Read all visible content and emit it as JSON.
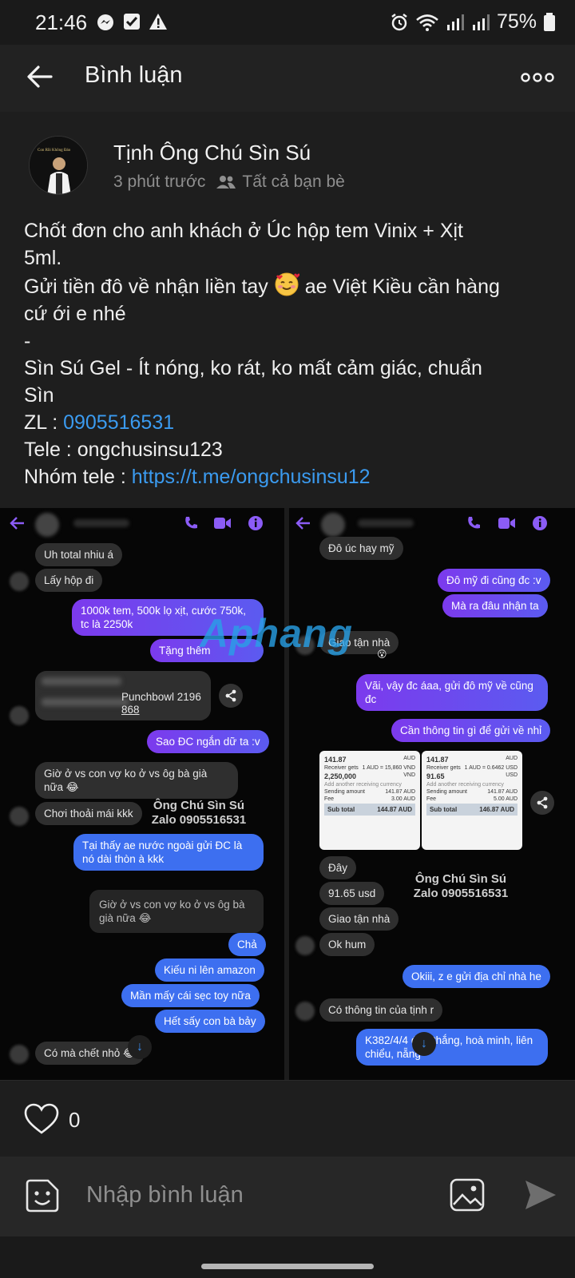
{
  "status_bar": {
    "time": "21:46",
    "battery": "75%"
  },
  "header": {
    "title": "Bình luận"
  },
  "post": {
    "author": "Tịnh Ông Chú Sìn Sú",
    "time": "3 phút trước",
    "audience": "Tất cả bạn bè",
    "lines": [
      "Chốt đơn cho anh khách ở Úc hộp tem Vinix + Xịt",
      "5ml.",
      "Gửi tiền đô về nhận liền tay",
      "ae Việt Kiều cần hàng",
      "cứ ới e nhé",
      "-",
      "Sìn Sú Gel - Ít nóng, ko rát, ko mất cảm giác, chuẩn",
      "Sìn",
      "ZL : ",
      "0905516531",
      "Tele : ongchusinsu123",
      "Nhóm tele : ",
      "https://t.me/ongchusinsu12"
    ]
  },
  "collage": {
    "brand": "Aphang",
    "left": {
      "messages": [
        "Uh total nhiu á",
        "Lấy hộp đi",
        "1000k tem, 500k lọ xịt, cước 750k, tc là 2250k",
        "Tặng thêm",
        "Punchbowl 2196",
        "868",
        "Sao ĐC ngắn dữ ta :v",
        "Giờ ở vs con vợ ko ở vs ôg bà già nữa 😂",
        "Chơi thoải mái kkk",
        "Tại thấy ae nước ngoài gửi ĐC là nó dài thòn à kkk",
        "Giờ ở vs con vợ ko ở vs ôg bà già nữa 😂",
        "Chả",
        "Kiếu ni lên amazon",
        "Mần mấy cái sẹc toy nữa",
        "Hết sấy con bà bảy",
        "Có mà chết nhỏ 😂"
      ],
      "watermark_name": "Ông Chú Sìn Sú",
      "watermark_zalo": "Zalo 0905516531"
    },
    "right": {
      "messages": [
        "Đô úc hay mỹ",
        "Đô mỹ đi cũng đc :v",
        "Mà ra đâu nhận ta",
        "Giao tận nhà",
        "Vãi, vậy đc áaa, gửi đô mỹ về cũng đc",
        "Cần thông tin gì để gửi về nhỉ",
        "Đây",
        "91.65 usd",
        "Giao tận nhà",
        "Ok hum",
        "Okiii, z e gửi địa chỉ nhà he",
        "Có thông tin của tịnh r",
        "K382/4/4",
        "đức thắng, hoà minh, liên chiểu,",
        "nẵng"
      ],
      "watermark_name": "Ông Chú Sìn Sú",
      "watermark_zalo": "Zalo 0905516531",
      "cards": [
        {
          "amount_top": "141.87",
          "cur_top": "AUD",
          "receiver_label": "Receiver gets",
          "receiver_amount": "2,250,000",
          "receiver_cur": "VND",
          "rate": "1 AUD = 15,860 VND",
          "add": "Add another receiving currency",
          "send_label": "Sending amount",
          "send_val": "141.87 AUD",
          "fee_label": "Fee",
          "fee_val": "3.00 AUD",
          "total_label": "Sub total",
          "total_val": "144.87 AUD"
        },
        {
          "amount_top": "141.87",
          "cur_top": "AUD",
          "receiver_label": "Receiver gets",
          "receiver_amount": "91.65",
          "receiver_cur": "USD",
          "rate": "1 AUD = 0.6462 USD",
          "add": "Add another receiving currency",
          "send_label": "Sending amount",
          "send_val": "141.87 AUD",
          "fee_label": "Fee",
          "fee_val": "5.00 AUD",
          "total_label": "Sub total",
          "total_val": "146.87 AUD"
        }
      ]
    }
  },
  "likes": {
    "count": "0"
  },
  "comment": {
    "placeholder": "Nhập bình luận"
  },
  "colors": {
    "link": "#3b9bf0",
    "bubble_out": "#7c3aed",
    "bubble_in": "#2f2f2f",
    "background": "#1e1e1e"
  },
  "icons": [
    "messenger-icon",
    "check-icon",
    "warning-icon",
    "alarm-icon",
    "wifi-icon",
    "signal-icon",
    "battery-icon",
    "back-arrow-icon",
    "more-icon",
    "friends-icon",
    "heart-icon",
    "sticker-icon",
    "image-icon",
    "send-icon"
  ]
}
